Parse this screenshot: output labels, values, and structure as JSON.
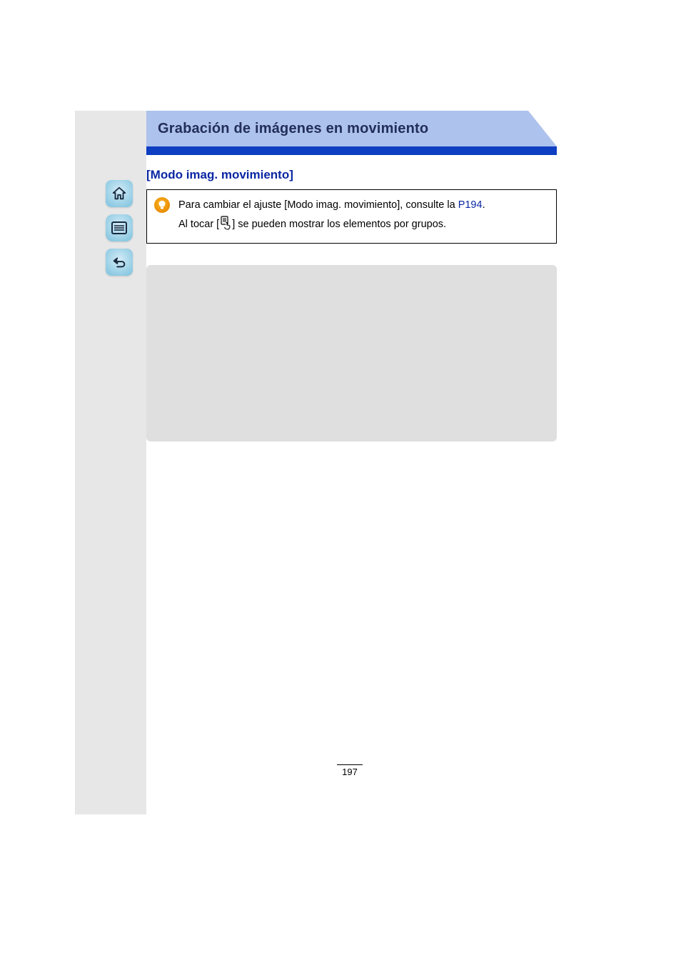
{
  "header": {
    "title": "Grabación de imágenes en movimiento"
  },
  "section": {
    "title": "[Modo imag. movimiento]"
  },
  "info_box": {
    "line1": "Para cambiar el ajuste [Modo imag. movimiento], consulte la ",
    "link_text": "P194",
    "link_suffix": ".",
    "line2_pre": "Al tocar [",
    "line2_post": "] se pueden mostrar los elementos por grupos."
  },
  "nav": {
    "home_label": "home",
    "menu_label": "menu",
    "back_label": "back"
  },
  "page_number": "197"
}
